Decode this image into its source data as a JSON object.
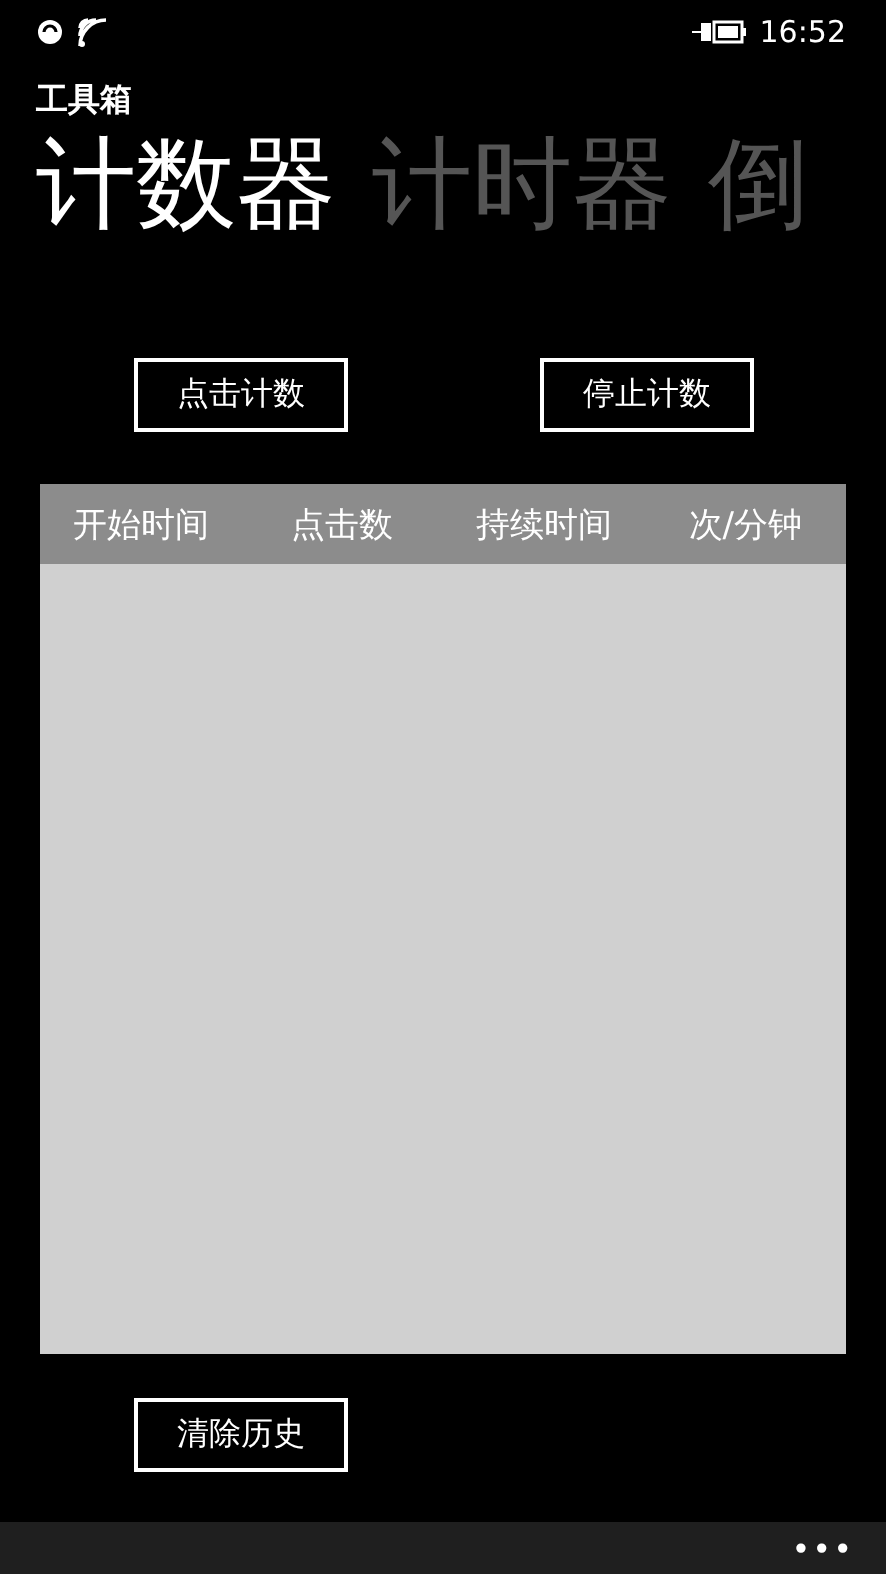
{
  "status_bar": {
    "time": "16:52"
  },
  "app_title": "工具箱",
  "pivot": [
    {
      "label": "计数器",
      "selected": true
    },
    {
      "label": "计时器",
      "selected": false
    },
    {
      "label": "倒",
      "selected": false
    }
  ],
  "buttons": [
    {
      "label": "点击计数"
    },
    {
      "label": "停止计数"
    }
  ],
  "table": {
    "columns": [
      "开始时间",
      "点击数",
      "持续时间",
      "次/分钟"
    ]
  },
  "clear_button": {
    "label": "清除历史"
  },
  "app_bar": {
    "more": "•••"
  }
}
